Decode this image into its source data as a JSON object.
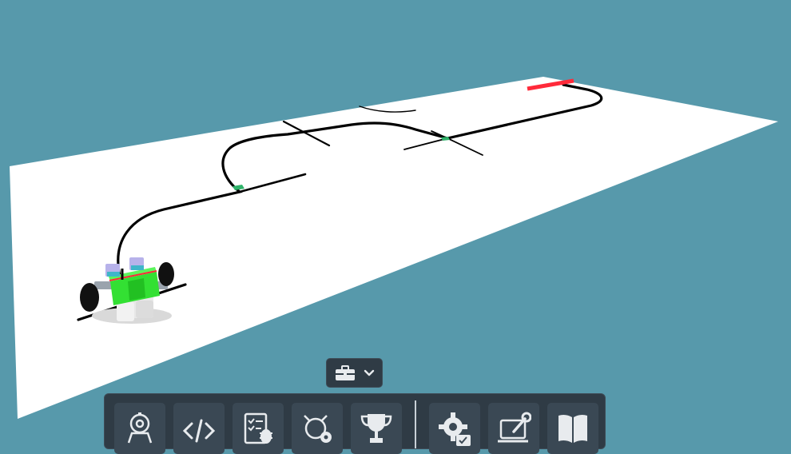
{
  "scene": {
    "background_color": "#5799ab",
    "mat_color": "#ffffff",
    "line_color": "#000000",
    "marker_colors": {
      "start_zone": "#ff2a3a",
      "checkpoint": "#2fb36a"
    },
    "robot_colors": {
      "body": "#33e033",
      "chassis": "#e8e8e8",
      "wheels": "#111111",
      "sensors": "#b7b2ea"
    }
  },
  "toolbox_toggle": {
    "icon": "briefcase-icon",
    "chevron": "chevron-down-icon"
  },
  "toolbar": {
    "buttons": [
      {
        "name": "robot-button",
        "icon": "robot-icon"
      },
      {
        "name": "code-button",
        "icon": "code-icon"
      },
      {
        "name": "tasks-button",
        "icon": "checklist-bug-icon"
      },
      {
        "name": "simulator-settings-button",
        "icon": "object-gear-icon"
      },
      {
        "name": "challenges-button",
        "icon": "trophy-icon"
      },
      {
        "name": "settings-button",
        "icon": "gear-check-icon"
      },
      {
        "name": "device-button",
        "icon": "laptop-wrench-icon"
      },
      {
        "name": "docs-button",
        "icon": "book-icon"
      }
    ]
  }
}
